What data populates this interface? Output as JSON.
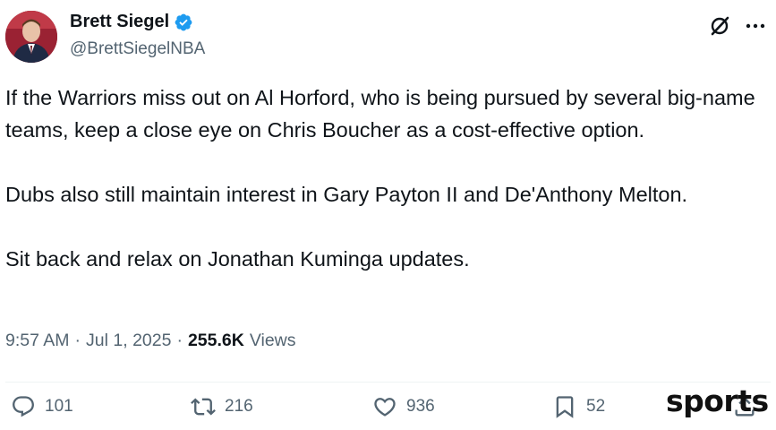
{
  "author": {
    "name": "Brett Siegel",
    "handle": "@BrettSiegelNBA",
    "verified": true,
    "avatar_icon": "avatar-photo"
  },
  "top_icons": [
    "grok-icon",
    "more-icon"
  ],
  "tweet": {
    "paragraphs": [
      "If the Warriors miss out on Al Horford, who is being pursued by several big-name teams, keep a close eye on Chris Boucher as a cost-effective option.",
      "Dubs also still maintain interest in Gary Payton II and De'Anthony Melton.",
      "Sit back and relax on Jonathan Kuminga updates."
    ]
  },
  "meta": {
    "time": "9:57 AM",
    "separator": "·",
    "date": "Jul 1, 2025",
    "views_count": "255.6K",
    "views_label": "Views"
  },
  "actions": {
    "reply_count": "101",
    "retweet_count": "216",
    "like_count": "936",
    "bookmark_count": "52"
  },
  "watermark": {
    "text": "sports"
  },
  "colors": {
    "text": "#0f1419",
    "secondary": "#536471",
    "verified": "#1d9bf0",
    "divider": "#eff3f4"
  }
}
